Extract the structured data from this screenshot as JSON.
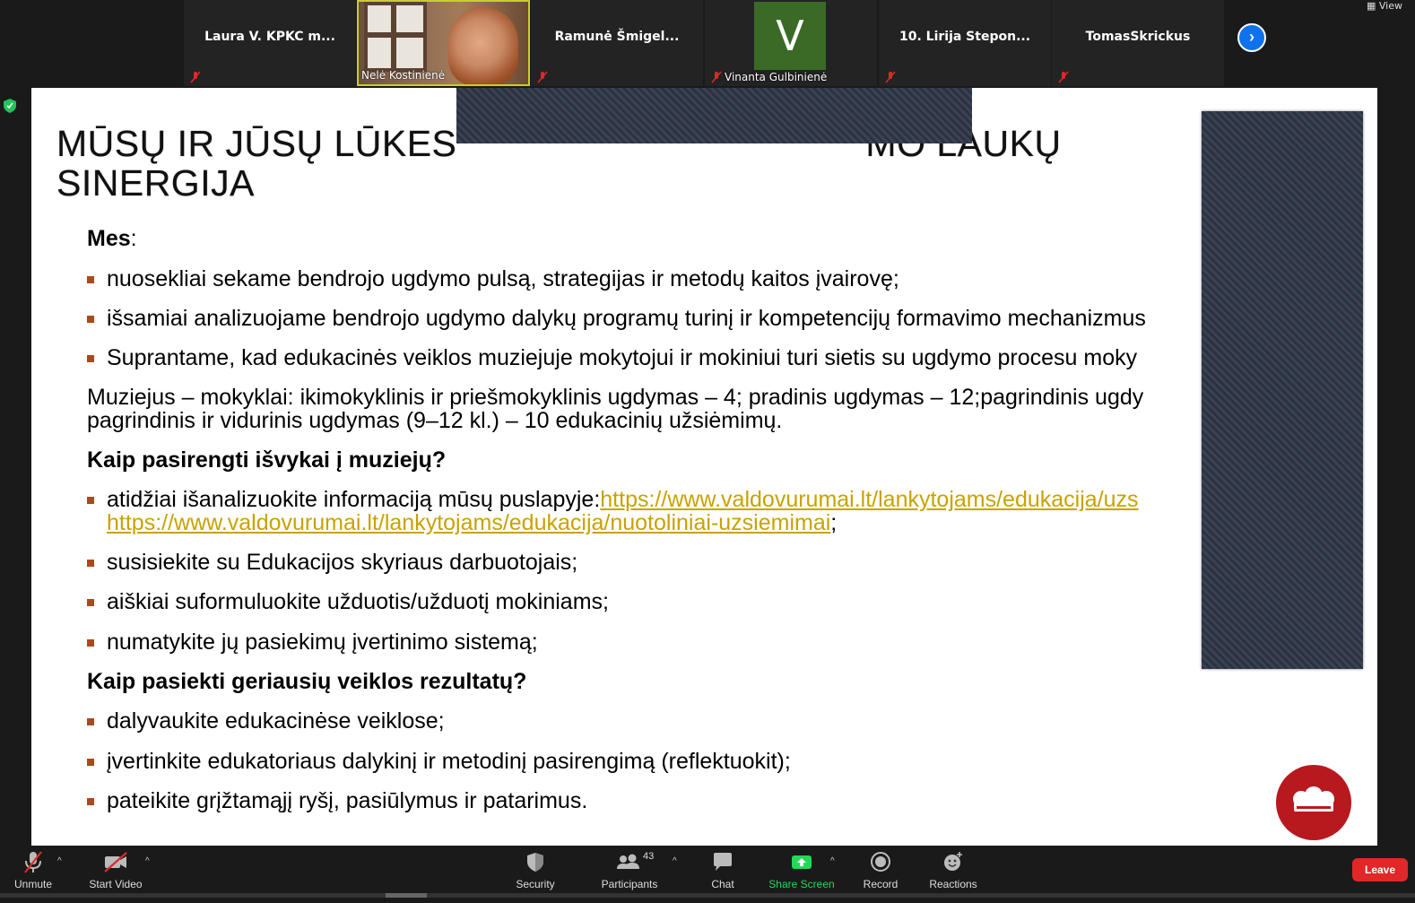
{
  "gallery": {
    "tiles": [
      {
        "name": "Laura V. KPKC m..."
      },
      {
        "label": "Nelė Kostinienė"
      },
      {
        "name": "Ramunė  Šmigel..."
      },
      {
        "avatar_letter": "V",
        "label": "Vinanta Gulbinienė",
        "avatar_color": "#3a6a26"
      },
      {
        "name": "10. Lirija Stepon..."
      },
      {
        "name": "TomasSkrickus"
      }
    ],
    "view_label": "View"
  },
  "slide": {
    "title_line1": "MŪSŲ IR JŪSŲ LŪKES",
    "title_line1_right": "MO LAUKŲ",
    "title_line2": "SINERGIJA",
    "heading_mes": "Mes",
    "colon": ":",
    "bullets_mes": [
      "nuosekliai sekame bendrojo ugdymo pulsą, strategijas ir metodų kaitos įvairovę;",
      "išsamiai analizuojame bendrojo ugdymo dalykų programų turinį ir kompetencijų formavimo mechanizmus",
      "Suprantame, kad edukacinės veiklos muziejuje mokytojui ir mokiniui turi sietis su ugdymo procesu moky"
    ],
    "para_line1": "Muziejus – mokyklai: ikimokyklinis ir priešmokyklinis ugdymas – 4; pradinis ugdymas – 12;pagrindinis ugdy",
    "para_line2": "pagrindinis ir vidurinis ugdymas (9–12 kl.) – 10 edukacinių užsiėmimų.",
    "heading_prep": "Kaip pasirengti išvykai į muziejų?",
    "bullet_info_text": "atidžiai išanalizuokite informaciją mūsų puslapyje:",
    "link1": "https://www.valdovurumai.lt/lankytojams/edukacija/uzs",
    "link2": "https://www.valdovurumai.lt/lankytojams/edukacija/nuotoliniai-uzsiemimai",
    "semicolon": ";",
    "bullets_prep": [
      "susisiekite su Edukacijos skyriaus darbuotojais;",
      "aiškiai suformuluokite užduotis/užduotį mokiniams;",
      "numatykite jų pasiekimų įvertinimo sistemą;"
    ],
    "heading_results": "Kaip pasiekti geriausių veiklos rezultatų?",
    "bullets_results": [
      "dalyvaukite edukacinėse veiklose;",
      "įvertinkite edukatoriaus dalykinį ir metodinį pasirengimą (reflektuokit);",
      "pateikite grįžtamąjį ryšį, pasiūlymus ir patarimus."
    ],
    "bullet_color": "#a94a1c",
    "link_color": "#c9a200",
    "logo_color": "#b7191f"
  },
  "toolbar": {
    "unmute": "Unmute",
    "start_video": "Start Video",
    "security": "Security",
    "participants": "Participants",
    "participants_count": "43",
    "chat": "Chat",
    "share_screen": "Share Screen",
    "record": "Record",
    "reactions": "Reactions",
    "leave": "Leave",
    "share_color": "#23d959",
    "leave_color": "#e02828"
  }
}
